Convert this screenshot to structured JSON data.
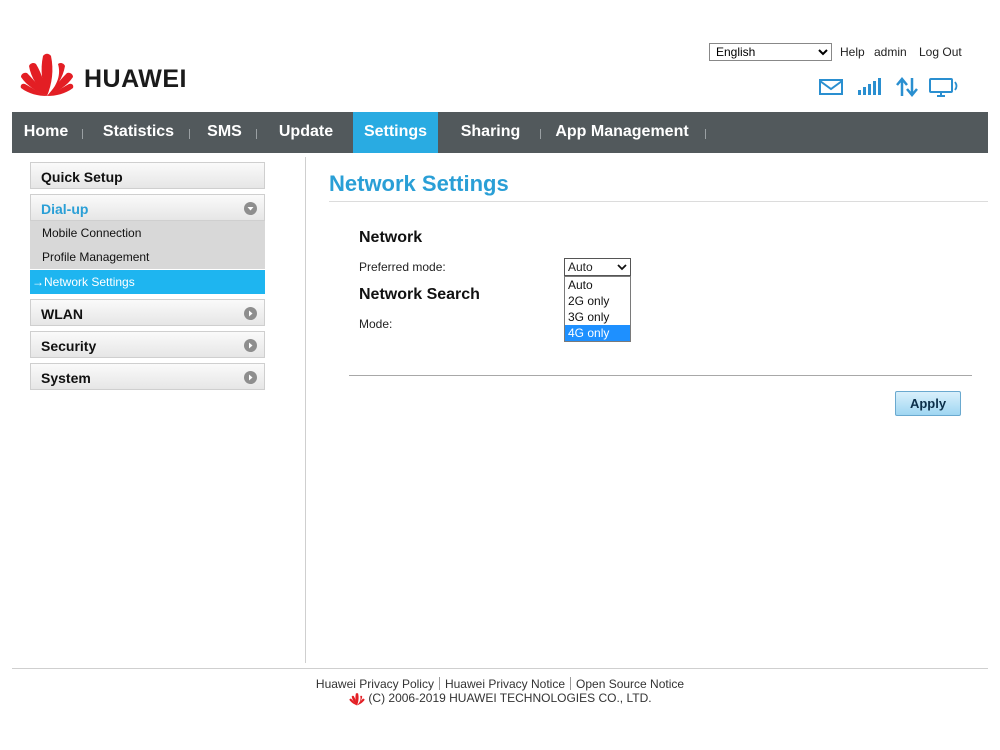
{
  "header": {
    "brand": "HUAWEI",
    "language_selected": "English",
    "links": {
      "help": "Help",
      "user": "admin",
      "logout": "Log Out"
    },
    "status_icons": [
      "mail-icon",
      "signal-strength-icon",
      "data-transfer-icon",
      "device-connection-icon"
    ]
  },
  "nav": {
    "items": [
      {
        "label": "Home"
      },
      {
        "label": "Statistics"
      },
      {
        "label": "SMS"
      },
      {
        "label": "Update"
      },
      {
        "label": "Settings",
        "active": true
      },
      {
        "label": "Sharing"
      },
      {
        "label": "App Management"
      }
    ]
  },
  "sidebar": {
    "groups": [
      {
        "label": "Quick Setup"
      },
      {
        "label": "Dial-up",
        "expanded": true
      },
      {
        "label": "WLAN"
      },
      {
        "label": "Security"
      },
      {
        "label": "System"
      }
    ],
    "dialup_items": [
      {
        "label": "Mobile Connection"
      },
      {
        "label": "Profile Management"
      },
      {
        "label": "Network Settings",
        "active": true,
        "prefix": "→"
      }
    ]
  },
  "main": {
    "title": "Network Settings",
    "network": {
      "heading": "Network",
      "preferred_mode_label": "Preferred mode:",
      "preferred_mode_value": "Auto",
      "options": [
        "Auto",
        "2G only",
        "3G only",
        "4G only"
      ],
      "highlighted_option": "4G only"
    },
    "network_search": {
      "heading": "Network Search",
      "mode_label": "Mode:"
    },
    "apply_label": "Apply"
  },
  "footer": {
    "links": [
      "Huawei Privacy Policy",
      "Huawei Privacy Notice",
      "Open Source Notice"
    ],
    "copyright": "(C) 2006-2019 HUAWEI TECHNOLOGIES CO., LTD."
  },
  "colors": {
    "nav_bg": "#52595c",
    "nav_active": "#29abe2",
    "sidebar_active": "#1eb5f0",
    "title": "#2a9fd6",
    "brand_red": "#e31e24"
  }
}
